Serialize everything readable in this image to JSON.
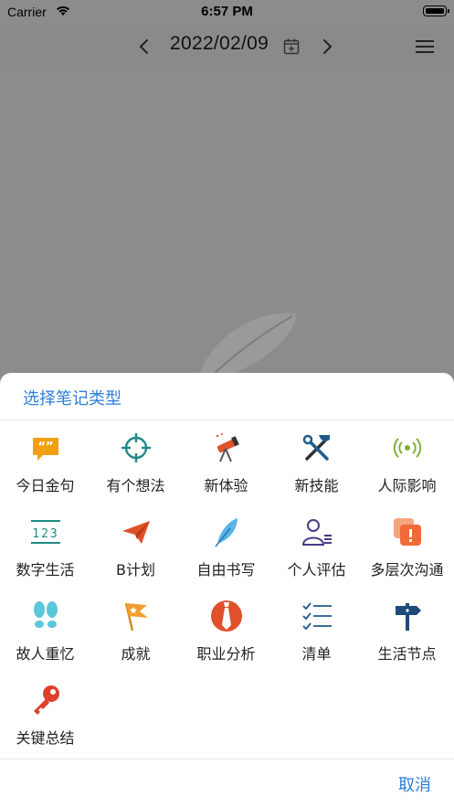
{
  "status": {
    "carrier": "Carrier",
    "time": "6:57 PM"
  },
  "navbar": {
    "date": "2022/02/09"
  },
  "sheet": {
    "title": "选择笔记类型",
    "cancel": "取消",
    "items": [
      {
        "label": "今日金句",
        "icon": "quote-bubble-icon",
        "color": "#f0a010"
      },
      {
        "label": "有个想法",
        "icon": "crosshair-icon",
        "color": "#1f8a86"
      },
      {
        "label": "新体验",
        "icon": "telescope-icon",
        "color": "#e0502a"
      },
      {
        "label": "新技能",
        "icon": "tools-icon",
        "color": "#1f5a8a"
      },
      {
        "label": "人际影响",
        "icon": "broadcast-icon",
        "color": "#7fb03a"
      },
      {
        "label": "数字生活",
        "icon": "numbers-icon",
        "color": "#1f8a86"
      },
      {
        "label": "B计划",
        "icon": "paper-plane-icon",
        "color": "#e0502a"
      },
      {
        "label": "自由书写",
        "icon": "feather-icon",
        "color": "#5ab4e8"
      },
      {
        "label": "个人评估",
        "icon": "person-list-icon",
        "color": "#4a3a8a"
      },
      {
        "label": "多层次沟通",
        "icon": "layers-alert-icon",
        "color": "#f06a3a"
      },
      {
        "label": "故人重忆",
        "icon": "footprints-icon",
        "color": "#5ac8d8"
      },
      {
        "label": "成就",
        "icon": "flag-icon",
        "color": "#f0a030"
      },
      {
        "label": "职业分析",
        "icon": "tie-icon",
        "color": "#e0502a"
      },
      {
        "label": "清单",
        "icon": "checklist-icon",
        "color": "#1f5a8a"
      },
      {
        "label": "生活节点",
        "icon": "signpost-icon",
        "color": "#1f4a7a"
      },
      {
        "label": "关键总结",
        "icon": "key-icon",
        "color": "#e0402a"
      }
    ]
  }
}
